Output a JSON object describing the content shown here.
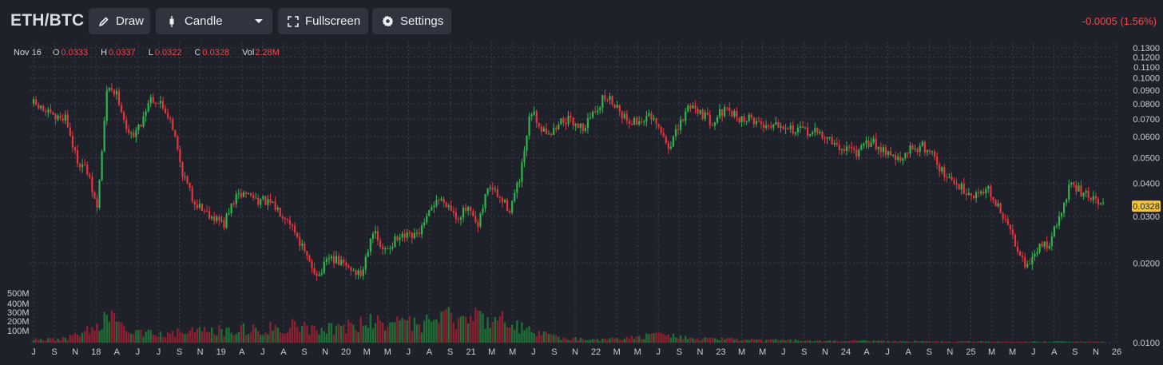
{
  "toolbar": {
    "pair": "ETH/BTC",
    "draw_label": "Draw",
    "chart_type_label": "Candle",
    "fullscreen_label": "Fullscreen",
    "settings_label": "Settings",
    "change_text": "-0.0005 (1.56%)"
  },
  "ohlc": {
    "date": "Nov 16",
    "o_label": "O",
    "o_value": "0.0333",
    "h_label": "H",
    "h_value": "0.0337",
    "l_label": "L",
    "l_value": "0.0322",
    "c_label": "C",
    "c_value": "0.0328",
    "vol_label": "Vol",
    "vol_value": "2.28M"
  },
  "colors": {
    "up": "#2fb54b",
    "down": "#e8333d",
    "volume_up": "#1f6e35",
    "volume_down": "#8a2030",
    "grid": "#3a3e49",
    "last_price": "#f0c43a"
  },
  "chart_data": {
    "type": "candlestick",
    "price_axis_ticks": [
      "0.1300",
      "0.1200",
      "0.1100",
      "0.1000",
      "0.0900",
      "0.0800",
      "0.0700",
      "0.0600",
      "0.0500",
      "0.0400",
      "0.0300",
      "0.0200",
      "0.0100"
    ],
    "volume_axis_ticks": [
      "500M",
      "400M",
      "300M",
      "200M",
      "100M"
    ],
    "last_price": "0.0328",
    "x_tick_labels": [
      "J",
      "S",
      "N",
      "18",
      "A",
      "J",
      "J",
      "S",
      "N",
      "19",
      "A",
      "J",
      "A",
      "S",
      "N",
      "20",
      "M",
      "M",
      "J",
      "A",
      "S",
      "21",
      "M",
      "M",
      "J",
      "S",
      "N",
      "22",
      "M",
      "M",
      "J",
      "S",
      "N",
      "23",
      "M",
      "M",
      "J",
      "S",
      "N",
      "24",
      "A",
      "J",
      "A",
      "S",
      "N",
      "25",
      "M",
      "M",
      "J",
      "A",
      "S",
      "N",
      "26"
    ],
    "price_series_approx": [
      {
        "t": "2017-06",
        "v": 0.08
      },
      {
        "t": "2017-07",
        "v": 0.075
      },
      {
        "t": "2017-08",
        "v": 0.07
      },
      {
        "t": "2017-09",
        "v": 0.072
      },
      {
        "t": "2017-10",
        "v": 0.05
      },
      {
        "t": "2017-11",
        "v": 0.045
      },
      {
        "t": "2017-12",
        "v": 0.032
      },
      {
        "t": "2018-01",
        "v": 0.095
      },
      {
        "t": "2018-02",
        "v": 0.085
      },
      {
        "t": "2018-03",
        "v": 0.06
      },
      {
        "t": "2018-04",
        "v": 0.065
      },
      {
        "t": "2018-05",
        "v": 0.085
      },
      {
        "t": "2018-06",
        "v": 0.08
      },
      {
        "t": "2018-07",
        "v": 0.07
      },
      {
        "t": "2018-08",
        "v": 0.045
      },
      {
        "t": "2018-09",
        "v": 0.035
      },
      {
        "t": "2018-10",
        "v": 0.032
      },
      {
        "t": "2018-11",
        "v": 0.03
      },
      {
        "t": "2018-12",
        "v": 0.028
      },
      {
        "t": "2019-01",
        "v": 0.035
      },
      {
        "t": "2019-02",
        "v": 0.037
      },
      {
        "t": "2019-03",
        "v": 0.035
      },
      {
        "t": "2019-04",
        "v": 0.034
      },
      {
        "t": "2019-05",
        "v": 0.032
      },
      {
        "t": "2019-06",
        "v": 0.03
      },
      {
        "t": "2019-07",
        "v": 0.025
      },
      {
        "t": "2019-08",
        "v": 0.02
      },
      {
        "t": "2019-09",
        "v": 0.018
      },
      {
        "t": "2019-10",
        "v": 0.021
      },
      {
        "t": "2019-11",
        "v": 0.02
      },
      {
        "t": "2019-12",
        "v": 0.019
      },
      {
        "t": "2020-01",
        "v": 0.018
      },
      {
        "t": "2020-02",
        "v": 0.027
      },
      {
        "t": "2020-03",
        "v": 0.022
      },
      {
        "t": "2020-04",
        "v": 0.024
      },
      {
        "t": "2020-05",
        "v": 0.025
      },
      {
        "t": "2020-06",
        "v": 0.025
      },
      {
        "t": "2020-07",
        "v": 0.028
      },
      {
        "t": "2020-08",
        "v": 0.035
      },
      {
        "t": "2020-09",
        "v": 0.034
      },
      {
        "t": "2020-10",
        "v": 0.03
      },
      {
        "t": "2020-11",
        "v": 0.032
      },
      {
        "t": "2020-12",
        "v": 0.027
      },
      {
        "t": "2021-01",
        "v": 0.04
      },
      {
        "t": "2021-02",
        "v": 0.035
      },
      {
        "t": "2021-03",
        "v": 0.032
      },
      {
        "t": "2021-04",
        "v": 0.042
      },
      {
        "t": "2021-05",
        "v": 0.075
      },
      {
        "t": "2021-06",
        "v": 0.065
      },
      {
        "t": "2021-07",
        "v": 0.062
      },
      {
        "t": "2021-08",
        "v": 0.07
      },
      {
        "t": "2021-09",
        "v": 0.068
      },
      {
        "t": "2021-10",
        "v": 0.065
      },
      {
        "t": "2021-11",
        "v": 0.075
      },
      {
        "t": "2021-12",
        "v": 0.085
      },
      {
        "t": "2022-01",
        "v": 0.08
      },
      {
        "t": "2022-02",
        "v": 0.07
      },
      {
        "t": "2022-03",
        "v": 0.068
      },
      {
        "t": "2022-04",
        "v": 0.072
      },
      {
        "t": "2022-05",
        "v": 0.065
      },
      {
        "t": "2022-06",
        "v": 0.055
      },
      {
        "t": "2022-07",
        "v": 0.065
      },
      {
        "t": "2022-08",
        "v": 0.08
      },
      {
        "t": "2022-09",
        "v": 0.075
      },
      {
        "t": "2022-10",
        "v": 0.068
      },
      {
        "t": "2022-11",
        "v": 0.075
      },
      {
        "t": "2022-12",
        "v": 0.073
      },
      {
        "t": "2023-01",
        "v": 0.07
      },
      {
        "t": "2023-02",
        "v": 0.07
      },
      {
        "t": "2023-03",
        "v": 0.066
      },
      {
        "t": "2023-04",
        "v": 0.068
      },
      {
        "t": "2023-05",
        "v": 0.067
      },
      {
        "t": "2023-06",
        "v": 0.063
      },
      {
        "t": "2023-07",
        "v": 0.063
      },
      {
        "t": "2023-08",
        "v": 0.062
      },
      {
        "t": "2023-09",
        "v": 0.06
      },
      {
        "t": "2023-10",
        "v": 0.054
      },
      {
        "t": "2023-11",
        "v": 0.055
      },
      {
        "t": "2023-12",
        "v": 0.052
      },
      {
        "t": "2024-01",
        "v": 0.058
      },
      {
        "t": "2024-02",
        "v": 0.055
      },
      {
        "t": "2024-03",
        "v": 0.052
      },
      {
        "t": "2024-04",
        "v": 0.048
      },
      {
        "t": "2024-05",
        "v": 0.055
      },
      {
        "t": "2024-06",
        "v": 0.055
      },
      {
        "t": "2024-07",
        "v": 0.052
      },
      {
        "t": "2024-08",
        "v": 0.043
      },
      {
        "t": "2024-09",
        "v": 0.04
      },
      {
        "t": "2024-10",
        "v": 0.038
      },
      {
        "t": "2024-11",
        "v": 0.036
      },
      {
        "t": "2024-12",
        "v": 0.039
      },
      {
        "t": "2025-01",
        "v": 0.033
      },
      {
        "t": "2025-02",
        "v": 0.028
      },
      {
        "t": "2025-03",
        "v": 0.023
      },
      {
        "t": "2025-04",
        "v": 0.019
      },
      {
        "t": "2025-05",
        "v": 0.023
      },
      {
        "t": "2025-06",
        "v": 0.024
      },
      {
        "t": "2025-07",
        "v": 0.03
      },
      {
        "t": "2025-08",
        "v": 0.04
      },
      {
        "t": "2025-09",
        "v": 0.037
      },
      {
        "t": "2025-10",
        "v": 0.035
      },
      {
        "t": "2025-11",
        "v": 0.0328
      }
    ],
    "volume_series_approx": [
      {
        "t": "2017-06",
        "v": 30
      },
      {
        "t": "2017-09",
        "v": 40
      },
      {
        "t": "2017-12",
        "v": 150
      },
      {
        "t": "2018-01",
        "v": 250
      },
      {
        "t": "2018-03",
        "v": 90
      },
      {
        "t": "2018-06",
        "v": 100
      },
      {
        "t": "2018-09",
        "v": 110
      },
      {
        "t": "2018-12",
        "v": 120
      },
      {
        "t": "2019-03",
        "v": 140
      },
      {
        "t": "2019-06",
        "v": 170
      },
      {
        "t": "2019-09",
        "v": 150
      },
      {
        "t": "2019-12",
        "v": 160
      },
      {
        "t": "2020-03",
        "v": 230
      },
      {
        "t": "2020-06",
        "v": 170
      },
      {
        "t": "2020-09",
        "v": 240
      },
      {
        "t": "2020-12",
        "v": 260
      },
      {
        "t": "2021-01",
        "v": 280
      },
      {
        "t": "2021-03",
        "v": 190
      },
      {
        "t": "2021-05",
        "v": 120
      },
      {
        "t": "2021-08",
        "v": 40
      },
      {
        "t": "2021-12",
        "v": 30
      },
      {
        "t": "2022-06",
        "v": 80
      },
      {
        "t": "2022-09",
        "v": 40
      },
      {
        "t": "2023-03",
        "v": 25
      },
      {
        "t": "2023-09",
        "v": 20
      },
      {
        "t": "2024-03",
        "v": 15
      },
      {
        "t": "2024-09",
        "v": 12
      },
      {
        "t": "2025-03",
        "v": 10
      },
      {
        "t": "2025-08",
        "v": 12
      },
      {
        "t": "2025-11",
        "v": 8
      }
    ],
    "y_scale": "log",
    "grid": true
  }
}
